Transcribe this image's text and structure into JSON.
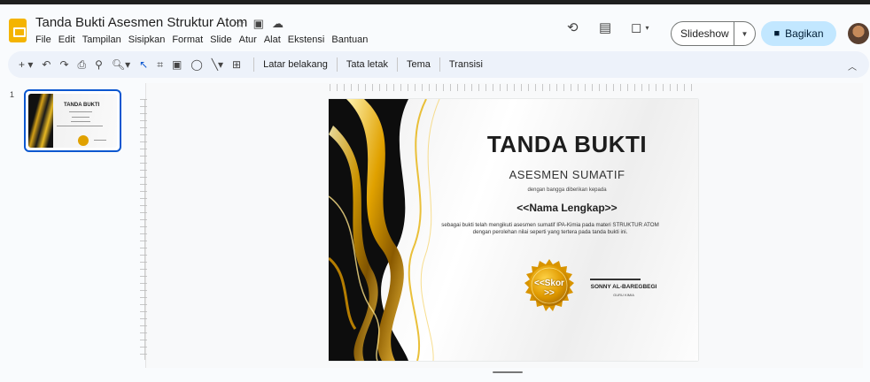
{
  "app": {
    "doc_title": "Tanda Bukti Asesmen Struktur Atom",
    "menu": [
      "File",
      "Edit",
      "Tampilan",
      "Sisipkan",
      "Format",
      "Slide",
      "Atur",
      "Alat",
      "Ekstensi",
      "Bantuan"
    ],
    "slideshow_label": "Slideshow",
    "share_label": "Bagikan"
  },
  "toolbar": {
    "background_label": "Latar belakang",
    "layout_label": "Tata letak",
    "theme_label": "Tema",
    "transition_label": "Transisi"
  },
  "filmstrip": {
    "slide_number": "1",
    "thumb_title": "TANDA BUKTI"
  },
  "slide": {
    "title": "TANDA BUKTI",
    "subtitle": "ASESMEN SUMATIF",
    "given_to": "dengan bangga diberikan kepada",
    "name_placeholder": "<<Nama Lengkap>>",
    "body_line1": "sebagai bukti telah mengikuti asesmen sumatif IPA-Kimia pada materi STRUKTUR ATOM",
    "body_line2": "dengan perolehan nilai seperti yang tertera pada  tanda bukti ini.",
    "score_line1": "<<Skor",
    "score_line2": ">>",
    "signer_name": "SONNY AL-BAREGBEGI",
    "signer_role": "GURU KIMIA"
  },
  "colors": {
    "accent_gold": "#e0a100",
    "share_bg": "#c2e7ff",
    "selection_blue": "#0b57d0"
  }
}
